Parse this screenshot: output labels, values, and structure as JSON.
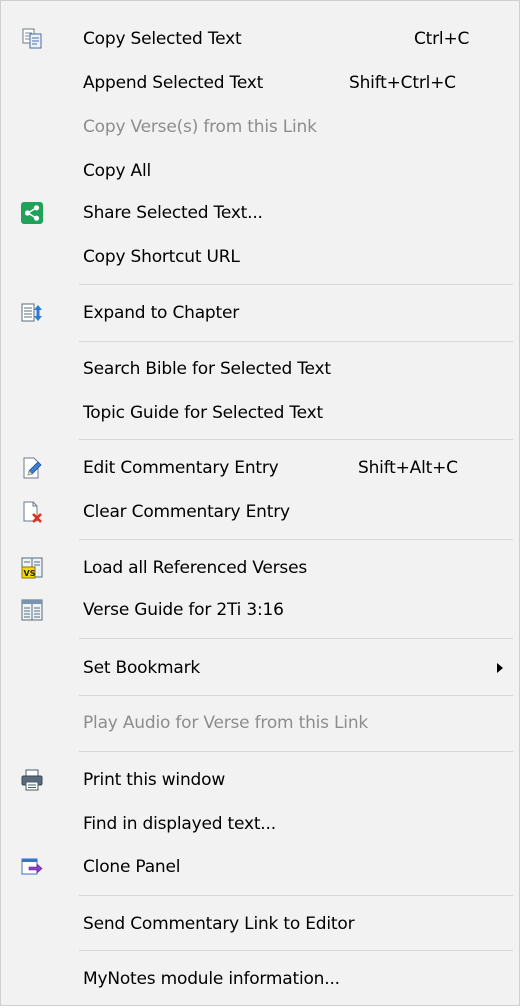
{
  "menu": {
    "copy_selected": {
      "label": "Copy Selected Text",
      "shortcut": "Ctrl+C"
    },
    "append_selected": {
      "label": "Append Selected Text",
      "shortcut": "Shift+Ctrl+C"
    },
    "copy_verses_link": {
      "label": "Copy Verse(s) from this Link"
    },
    "copy_all": {
      "label": "Copy All"
    },
    "share_selected": {
      "label": "Share Selected Text..."
    },
    "copy_shortcut_url": {
      "label": "Copy Shortcut URL"
    },
    "expand_chapter": {
      "label": "Expand to Chapter"
    },
    "search_bible": {
      "label": "Search Bible for Selected Text"
    },
    "topic_guide": {
      "label": "Topic Guide for Selected Text"
    },
    "edit_commentary": {
      "label": "Edit Commentary Entry",
      "shortcut": "Shift+Alt+C"
    },
    "clear_commentary": {
      "label": "Clear Commentary Entry"
    },
    "load_referenced": {
      "label": "Load all Referenced Verses"
    },
    "verse_guide": {
      "label": "Verse Guide for 2Ti 3:16"
    },
    "set_bookmark": {
      "label": "Set Bookmark"
    },
    "play_audio": {
      "label": "Play Audio for Verse from this Link"
    },
    "print_window": {
      "label": "Print this window"
    },
    "find_displayed": {
      "label": "Find in displayed text..."
    },
    "clone_panel": {
      "label": "Clone Panel"
    },
    "send_commentary_link": {
      "label": "Send Commentary Link to Editor"
    },
    "module_info": {
      "label": "MyNotes module information..."
    }
  },
  "icons": {
    "copy": "copy-icon",
    "share": "share-icon",
    "expand": "expand-chapter-icon",
    "edit": "edit-commentary-icon",
    "clear": "clear-commentary-icon",
    "load": "load-verses-icon",
    "verse_guide": "verse-guide-icon",
    "print": "printer-icon",
    "clone": "clone-panel-icon",
    "share_color": "#1fa35a"
  }
}
